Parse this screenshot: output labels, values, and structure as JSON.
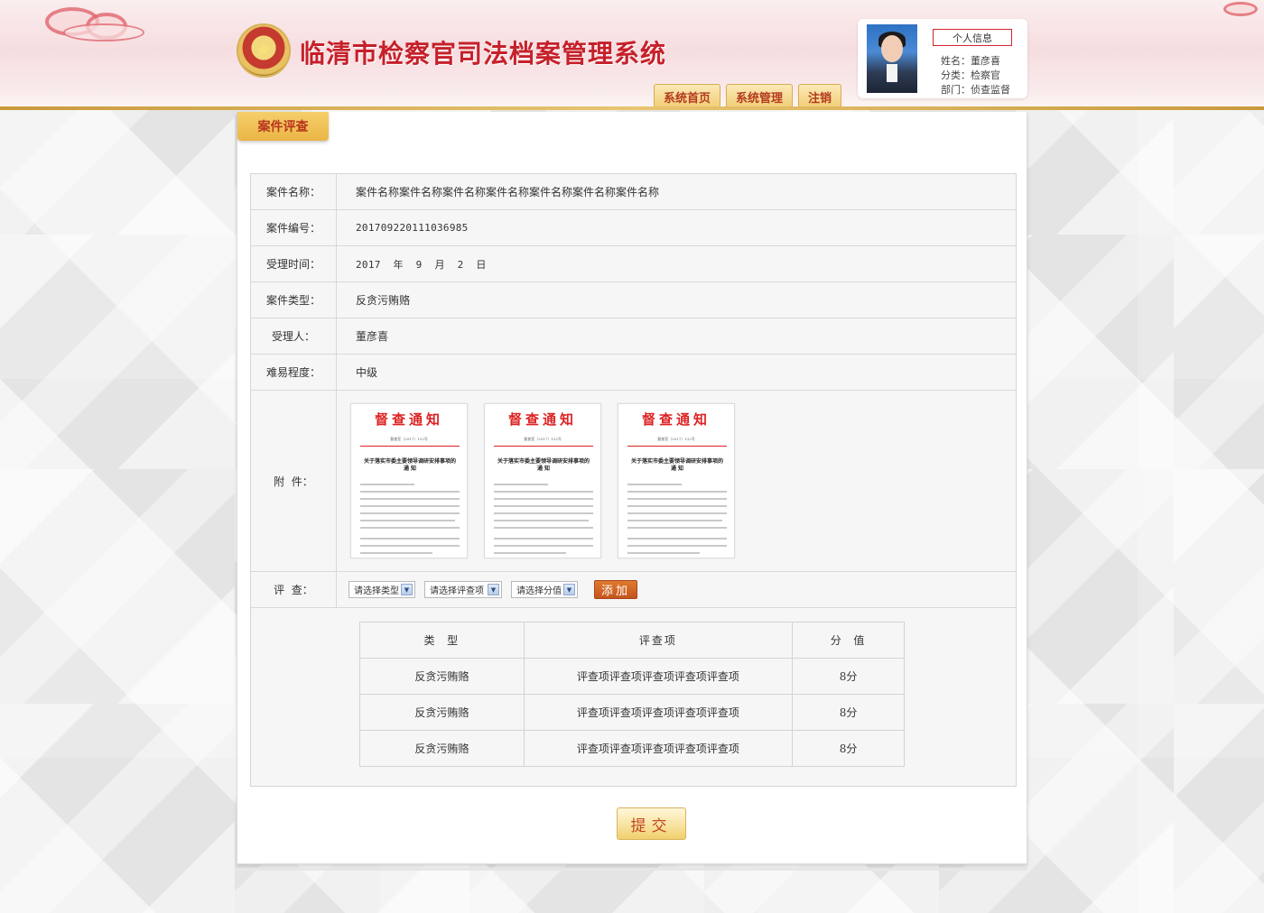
{
  "header": {
    "title": "临清市检察官司法档案管理系统",
    "nav": [
      "系统首页",
      "系统管理",
      "注销"
    ],
    "profile": {
      "button": "个人信息",
      "name": "姓名：董彦喜",
      "category": "分类：检察官",
      "department": "部门：侦查监督"
    }
  },
  "section_tab": "案件评查",
  "form": {
    "case_name": {
      "label": "案件名称：",
      "value": "案件名称案件名称案件名称案件名称案件名称案件名称案件名称"
    },
    "case_number": {
      "label": "案件编号：",
      "value": "201709220111036985"
    },
    "accept_time": {
      "label": "受理时间：",
      "value": "2017  年  9  月  2  日"
    },
    "case_type": {
      "label": "案件类型：",
      "value": "反贪污贿赂"
    },
    "acceptor": {
      "label": "受理人：",
      "value": "董彦喜"
    },
    "difficulty": {
      "label": "难易程度：",
      "value": "中级"
    },
    "attachment": {
      "label": "附  件：",
      "docs": [
        {
          "title": "督查通知",
          "number": "督查室〔2017〕132号",
          "heading": "关于落实市委主要领导调研安排事项的通  知"
        },
        {
          "title": "督查通知",
          "number": "督查室〔2017〕132号",
          "heading": "关于落实市委主要领导调研安排事项的通  知"
        },
        {
          "title": "督查通知",
          "number": "督查室〔2017〕132号",
          "heading": "关于落实市委主要领导调研安排事项的通  知"
        }
      ]
    },
    "review": {
      "label": "评  查：",
      "select_type": "请选择类型",
      "select_item": "请选择评查项",
      "select_score": "请选择分值",
      "add_button": "添加"
    }
  },
  "review_table": {
    "headers": [
      "类  型",
      "评查项",
      "分  值"
    ],
    "rows": [
      [
        "反贪污贿赂",
        "评查项评查项评查项评查项评查项",
        "8分"
      ],
      [
        "反贪污贿赂",
        "评查项评查项评查项评查项评查项",
        "8分"
      ],
      [
        "反贪污贿赂",
        "评查项评查项评查项评查项评查项",
        "8分"
      ]
    ]
  },
  "submit_button": "提交",
  "colors": {
    "brand_red": "#c6202a",
    "gold": "#eab545",
    "accent_orange": "#c4541a"
  }
}
